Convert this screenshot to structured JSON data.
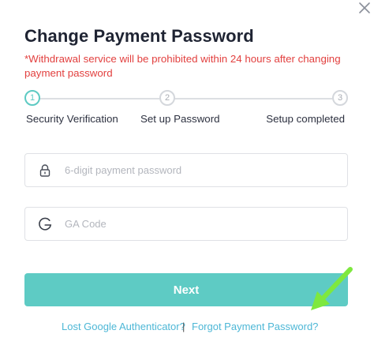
{
  "dialog": {
    "title": "Change Payment Password",
    "warning": "*Withdrawal service will be prohibited within 24 hours after changing payment password",
    "close_icon": "close-icon"
  },
  "stepper": {
    "steps": [
      {
        "number": "1",
        "label": "Security Verification",
        "state": "active"
      },
      {
        "number": "2",
        "label": "Set up Password",
        "state": "pending"
      },
      {
        "number": "3",
        "label": "Setup completed",
        "state": "pending"
      }
    ]
  },
  "form": {
    "payment_password": {
      "placeholder": "6-digit payment password",
      "value": "",
      "icon": "lock-icon"
    },
    "ga_code": {
      "placeholder": "GA Code",
      "value": "",
      "icon": "google-g-icon"
    }
  },
  "actions": {
    "next_label": "Next",
    "lost_ga_label": "Lost Google Authenticator?",
    "separator": "|",
    "forgot_password_label": "Forgot Payment Password?"
  },
  "colors": {
    "accent": "#5ecbc4",
    "warning": "#e2403f",
    "link": "#4db7d6",
    "annotation_arrow": "#7ee83f"
  }
}
